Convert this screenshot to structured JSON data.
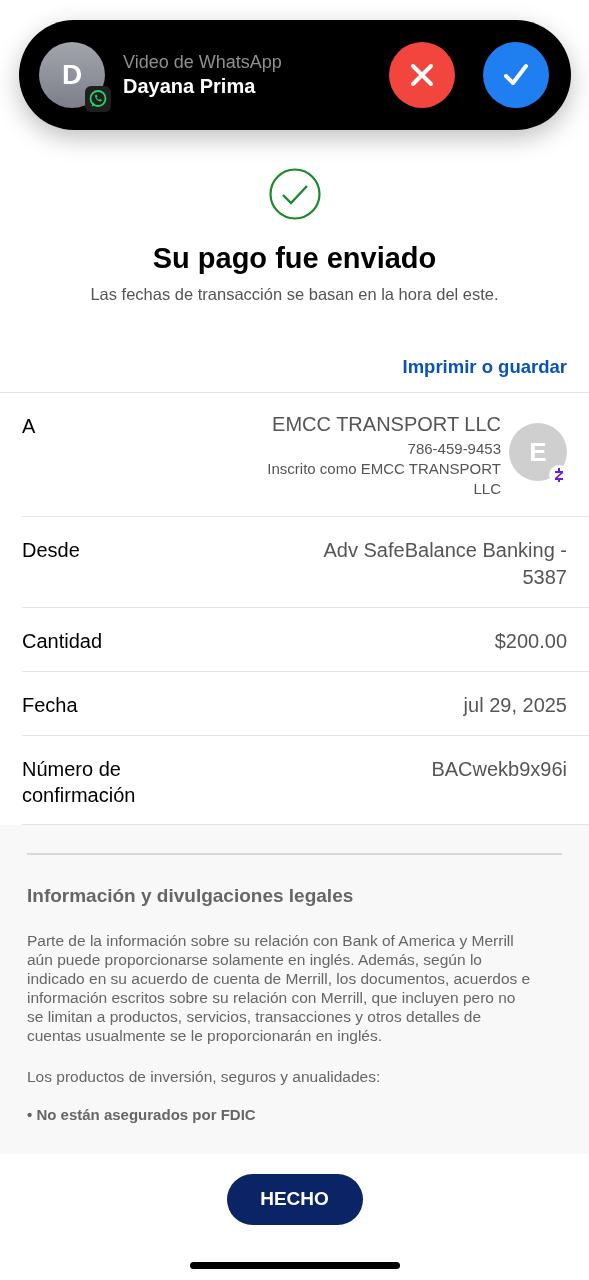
{
  "notification": {
    "app": "Video de WhatsApp",
    "caller": "Dayana Prima",
    "avatar_letter": "D"
  },
  "header": {
    "title": "Su pago fue enviado",
    "subtitle": "Las fechas de transacción se basan en la hora del este."
  },
  "print_link": "Imprimir o guardar",
  "details": [
    {
      "kind": "recipient",
      "label": "A",
      "name": "EMCC TRANSPORT LLC",
      "phone": "786-459-9453",
      "enrolled": "Inscrito como EMCC TRANSPORT LLC",
      "avatar_letter": "E"
    },
    {
      "kind": "simple",
      "label": "Desde",
      "value": "Adv SafeBalance Banking - 5387"
    },
    {
      "kind": "simple",
      "label": "Cantidad",
      "value": "$200.00"
    },
    {
      "kind": "simple",
      "label": "Fecha",
      "value": "jul 29, 2025"
    },
    {
      "kind": "simple",
      "label": "Número de confirmación",
      "value": "BACwekb9x96i"
    }
  ],
  "legal": {
    "title": "Información y divulgaciones legales",
    "paragraphs": [
      "Parte de la información sobre su relación con Bank of America y Merrill aún puede proporcionarse solamente en inglés. Además, según lo indicado en su acuerdo de cuenta de Merrill, los documentos, acuerdos e información escritos sobre su relación con Merrill, que incluyen pero no se limitan a productos, servicios, transacciones y otros detalles de cuentas usualmente se le proporcionarán en inglés.",
      "Los productos de inversión, seguros y anualidades:"
    ],
    "bullet": "• No están asegurados por FDIC"
  },
  "done_button": "HECHO"
}
